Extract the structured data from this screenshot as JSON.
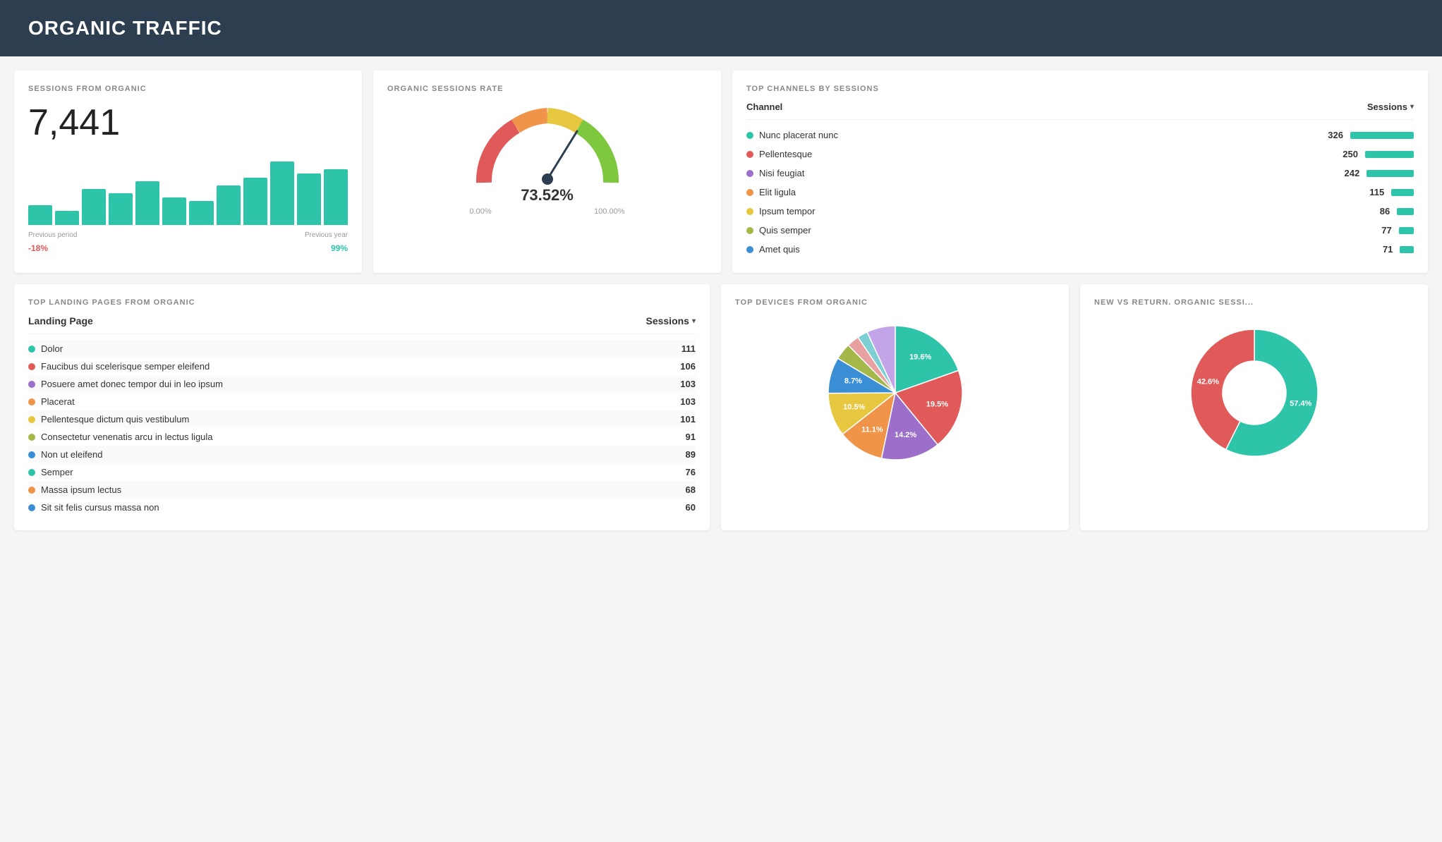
{
  "header": {
    "title": "ORGANIC TRAFFIC"
  },
  "sessions_from_organic": {
    "title": "SESSIONS FROM ORGANIC",
    "value": "7,441",
    "bars": [
      25,
      18,
      45,
      40,
      55,
      35,
      30,
      50,
      60,
      80,
      65,
      70
    ],
    "labels": [
      "Previous period",
      "Previous year"
    ],
    "changes": [
      "-18%",
      "99%"
    ]
  },
  "organic_sessions_rate": {
    "title": "ORGANIC SESSIONS RATE",
    "percent": "73.52%",
    "min_label": "0.00%",
    "max_label": "100.00%",
    "value": 73.52
  },
  "top_channels": {
    "title": "TOP CHANNELS BY SESSIONS",
    "col1": "Channel",
    "col2": "Sessions",
    "rows": [
      {
        "name": "Nunc placerat nunc",
        "value": 326,
        "color": "#2ec4a9",
        "bar": 100
      },
      {
        "name": "Pellentesque",
        "value": 250,
        "color": "#e05a5a",
        "bar": 76
      },
      {
        "name": "Nisi feugiat",
        "value": 242,
        "color": "#9b6fca",
        "bar": 74
      },
      {
        "name": "Elit ligula",
        "value": 115,
        "color": "#f0944a",
        "bar": 35
      },
      {
        "name": "Ipsum tempor",
        "value": 86,
        "color": "#e8c740",
        "bar": 26
      },
      {
        "name": "Quis semper",
        "value": 77,
        "color": "#a4b84a",
        "bar": 23
      },
      {
        "name": "Amet quis",
        "value": 71,
        "color": "#3a8fd4",
        "bar": 21
      }
    ]
  },
  "top_landing_pages": {
    "title": "TOP LANDING PAGES FROM ORGANIC",
    "col1": "Landing Page",
    "col2": "Sessions",
    "rows": [
      {
        "name": "Dolor",
        "value": 111,
        "color": "#2ec4a9"
      },
      {
        "name": "Faucibus dui scelerisque semper eleifend",
        "value": 106,
        "color": "#e05a5a"
      },
      {
        "name": "Posuere amet donec tempor dui in leo ipsum",
        "value": 103,
        "color": "#9b6fca"
      },
      {
        "name": "Placerat",
        "value": 103,
        "color": "#f0944a"
      },
      {
        "name": "Pellentesque dictum quis vestibulum",
        "value": 101,
        "color": "#e8c740"
      },
      {
        "name": "Consectetur venenatis arcu in lectus ligula",
        "value": 91,
        "color": "#a4b84a"
      },
      {
        "name": "Non ut eleifend",
        "value": 89,
        "color": "#3a8fd4"
      },
      {
        "name": "Semper",
        "value": 76,
        "color": "#2ec4a9"
      },
      {
        "name": "Massa ipsum lectus",
        "value": 68,
        "color": "#f0944a"
      },
      {
        "name": "Sit sit felis cursus massa non",
        "value": 60,
        "color": "#3a8fd4"
      }
    ]
  },
  "top_devices": {
    "title": "TOP DEVICES FROM ORGANIC",
    "segments": [
      {
        "label": "19.6%",
        "value": 19.6,
        "color": "#2ec4a9"
      },
      {
        "label": "19.5%",
        "value": 19.5,
        "color": "#e05a5a"
      },
      {
        "label": "14.2%",
        "value": 14.2,
        "color": "#9b6fca"
      },
      {
        "label": "11.1%",
        "value": 11.1,
        "color": "#f0944a"
      },
      {
        "label": "10.5%",
        "value": 10.5,
        "color": "#e8c740"
      },
      {
        "label": "8.7%",
        "value": 8.7,
        "color": "#3a8fd4"
      },
      {
        "label": "4.0%",
        "value": 4.0,
        "color": "#a4b84a"
      },
      {
        "label": "3.0%",
        "value": 3.0,
        "color": "#e8a0a0"
      },
      {
        "label": "2.5%",
        "value": 2.5,
        "color": "#7ecfd4"
      },
      {
        "label": "6.9%",
        "value": 6.9,
        "color": "#c4a4e8"
      }
    ]
  },
  "new_vs_return": {
    "title": "NEW VS RETURN. ORGANIC SESSI...",
    "segments": [
      {
        "label": "57.4%",
        "value": 57.4,
        "color": "#2ec4a9"
      },
      {
        "label": "42.6%",
        "value": 42.6,
        "color": "#e05a5a"
      }
    ]
  }
}
